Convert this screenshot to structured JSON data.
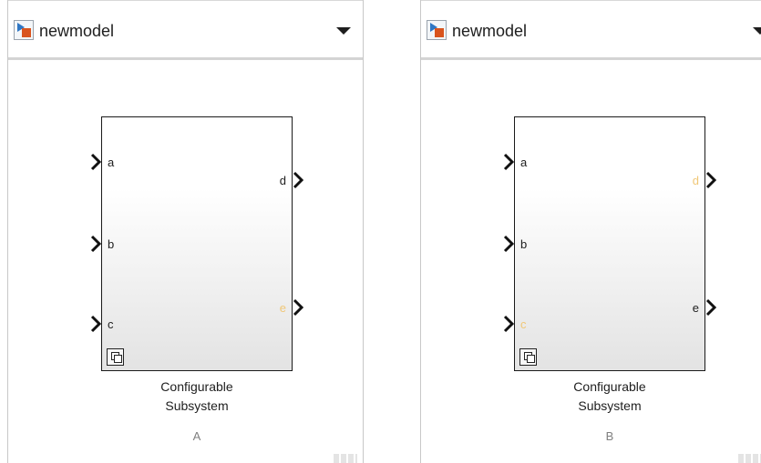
{
  "panels": [
    {
      "id": "a",
      "header": {
        "model_name": "newmodel"
      },
      "block": {
        "inputs": [
          {
            "label": "a",
            "dim": false
          },
          {
            "label": "b",
            "dim": false
          },
          {
            "label": "c",
            "dim": false
          }
        ],
        "outputs": [
          {
            "label": "d",
            "dim": false
          },
          {
            "label": "e",
            "dim": true
          }
        ],
        "caption_line1": "Configurable",
        "caption_line2": "Subsystem",
        "variant": "A"
      }
    },
    {
      "id": "b",
      "header": {
        "model_name": "newmodel"
      },
      "block": {
        "inputs": [
          {
            "label": "a",
            "dim": false
          },
          {
            "label": "b",
            "dim": false
          },
          {
            "label": "c",
            "dim": true
          }
        ],
        "outputs": [
          {
            "label": "d",
            "dim": true
          },
          {
            "label": "e",
            "dim": false
          }
        ],
        "caption_line1": "Configurable",
        "caption_line2": "Subsystem",
        "variant": "B"
      }
    }
  ],
  "colors": {
    "dim_port": "#f0c777",
    "model_icon_triangle": "#2f77c4",
    "model_icon_box": "#d9541e"
  },
  "icons": [
    "model-icon",
    "chevron-down-icon",
    "port-arrow-icon",
    "subsystem-icon",
    "resize-grip-icon"
  ]
}
